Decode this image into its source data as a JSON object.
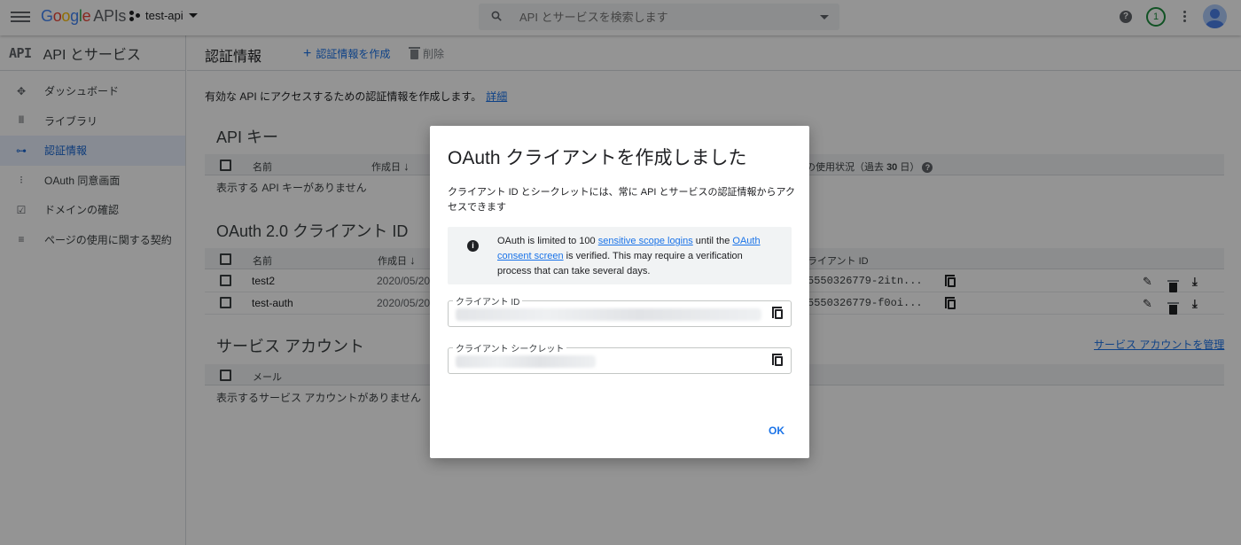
{
  "topbar": {
    "logo_google": [
      "G",
      "o",
      "o",
      "g",
      "l",
      "e"
    ],
    "logo_apis": "APIs",
    "project": "test-api",
    "search_placeholder": "API とサービスを検索します",
    "notifications_count": "1"
  },
  "sidebar": {
    "logo": "API",
    "title": "API とサービス",
    "items": [
      {
        "label": "ダッシュボード",
        "icon": "dashboard-icon",
        "glyph": "✥",
        "active": false
      },
      {
        "label": "ライブラリ",
        "icon": "library-icon",
        "glyph": "𝍫",
        "active": false
      },
      {
        "label": "認証情報",
        "icon": "key-icon",
        "glyph": "⊶",
        "active": true
      },
      {
        "label": "OAuth 同意画面",
        "icon": "consent-icon",
        "glyph": "⁝",
        "active": false
      },
      {
        "label": "ドメインの確認",
        "icon": "domain-check-icon",
        "glyph": "☑",
        "active": false
      },
      {
        "label": "ページの使用に関する契約",
        "icon": "settings-list-icon",
        "glyph": "≡",
        "active": false
      }
    ]
  },
  "main": {
    "title": "認証情報",
    "create_label": "認証情報を作成",
    "delete_label": "削除",
    "intro_text": "有効な API にアクセスするための認証情報を作成します。",
    "intro_link": "詳細",
    "api_keys": {
      "title": "API キー",
      "col_name": "名前",
      "col_created": "作成日",
      "col_usage_prefix": "の使用状況（過去 ",
      "col_usage_bold": "30",
      "col_usage_suffix": " 日）",
      "empty": "表示する API キーがありません"
    },
    "oauth": {
      "title": "OAuth 2.0 クライアント ID",
      "col_name": "名前",
      "col_created": "作成日",
      "col_client_id": "ライアント ID",
      "rows": [
        {
          "name": "test2",
          "date": "2020/05/20",
          "client_id": "5550326779-2itn..."
        },
        {
          "name": "test-auth",
          "date": "2020/05/20",
          "client_id": "5550326779-f0oi..."
        }
      ]
    },
    "service_accounts": {
      "title": "サービス アカウント",
      "manage_link": "サービス アカウントを管理",
      "col_email": "メール",
      "empty": "表示するサービス アカウントがありません"
    }
  },
  "dialog": {
    "title": "OAuth クライアントを作成しました",
    "description": "クライアント ID とシークレットには、常に API とサービスの認証情報からアクセスできます",
    "notice_part1": "OAuth is limited to 100 ",
    "notice_link1": "sensitive scope logins",
    "notice_part2": " until the ",
    "notice_link2": "OAuth consent screen",
    "notice_part3": " is verified. This may require a verification process that can take several days.",
    "client_id_label": "クライアント ID",
    "client_secret_label": "クライアント シークレット",
    "ok_label": "OK"
  },
  "colors": {
    "accent": "#1a73e8",
    "active_bg": "#e8f0fe",
    "notification_ring": "#1e8e3e"
  }
}
